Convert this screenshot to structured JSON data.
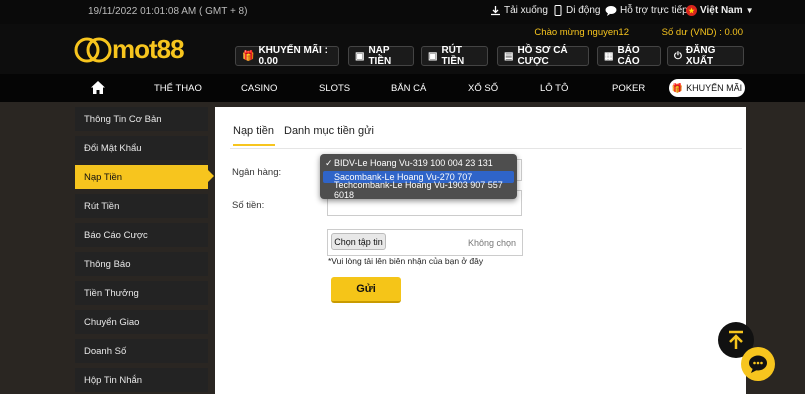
{
  "topbar": {
    "datetime": "19/11/2022 01:01:08 AM ( GMT + 8)",
    "download": "Tải xuống",
    "mobile": "Di động",
    "support": "Hỗ trợ trực tiếp",
    "language": "Việt Nam"
  },
  "header": {
    "logo_text": "mot88",
    "welcome": "Chào mừng nguyen12",
    "balance": "Số dư (VND) : 0.00",
    "buttons": [
      "KHUYẾN MÃI : 0.00",
      "NẠP TIỀN",
      "RÚT TIỀN",
      "HỒ SƠ CÁ CƯỢC",
      "BÁO CÁO",
      "ĐĂNG XUẤT"
    ]
  },
  "nav": {
    "items": [
      "THỂ THAO",
      "CASINO",
      "SLOTS",
      "BẮN CÁ",
      "XỔ SỐ",
      "LÔ TÔ",
      "POKER"
    ],
    "promo": "KHUYẾN MÃI"
  },
  "sidebar": {
    "items": [
      "Thông Tin Cơ Bản",
      "Đổi Mật Khẩu",
      "Nạp Tiền",
      "Rút Tiền",
      "Báo Cáo Cược",
      "Thông Báo",
      "Tiền Thưởng",
      "Chuyển Giao",
      "Doanh Số",
      "Hộp Tin Nhắn"
    ],
    "active_index": 2
  },
  "panel": {
    "tabs": [
      "Nạp tiền",
      "Danh mục tiền gửi"
    ],
    "bank_label": "Ngân hàng:",
    "amount_label": "Số tiền:",
    "bank_options": [
      "BIDV-Le Hoang Vu-319 100 004 23 131",
      "Sacombank-Le Hoang Vu-270 707",
      "Techcombank-Le Hoang Vu-1903 907 557 6018"
    ],
    "checked_mark": "✓",
    "choose_file": "Chọn tập tin",
    "no_file": "Không chọn",
    "upload_note": "*Vui lòng tải lên biên nhận của bạn ở đây",
    "submit": "Gửi"
  },
  "colors": {
    "accent": "#f7c51e",
    "highlight": "#2f64c8"
  }
}
